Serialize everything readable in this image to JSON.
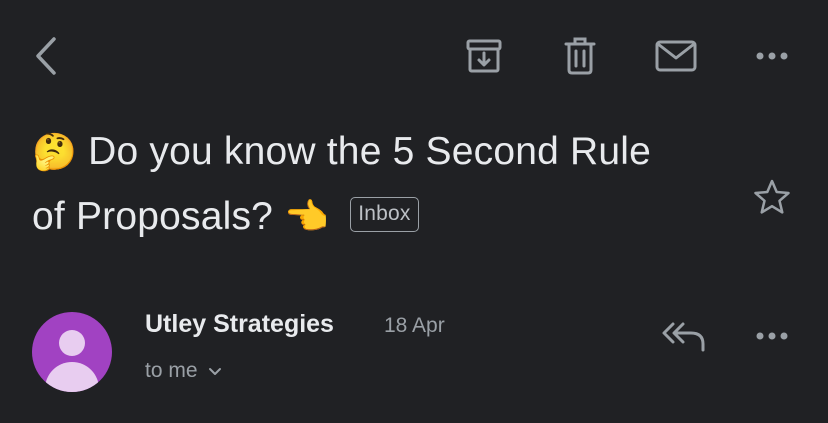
{
  "toolbar": {
    "icons": [
      "back-icon",
      "archive-icon",
      "delete-icon",
      "mark-unread-icon",
      "more-icon"
    ]
  },
  "message": {
    "subject_line1": "Do you know the 5 Second Rule",
    "subject_line2": "of Proposals?",
    "emoji_start": "🤔",
    "emoji_end": "👈",
    "label": "Inbox"
  },
  "sender": {
    "name": "Utley Strategies",
    "date": "18 Apr",
    "recipient": "to me",
    "avatar_color": "#a142c2"
  },
  "colors": {
    "background": "#202124",
    "text": "#e8eaed",
    "icon": "#9aa0a6",
    "secondary_text": "#9aa0a6"
  }
}
